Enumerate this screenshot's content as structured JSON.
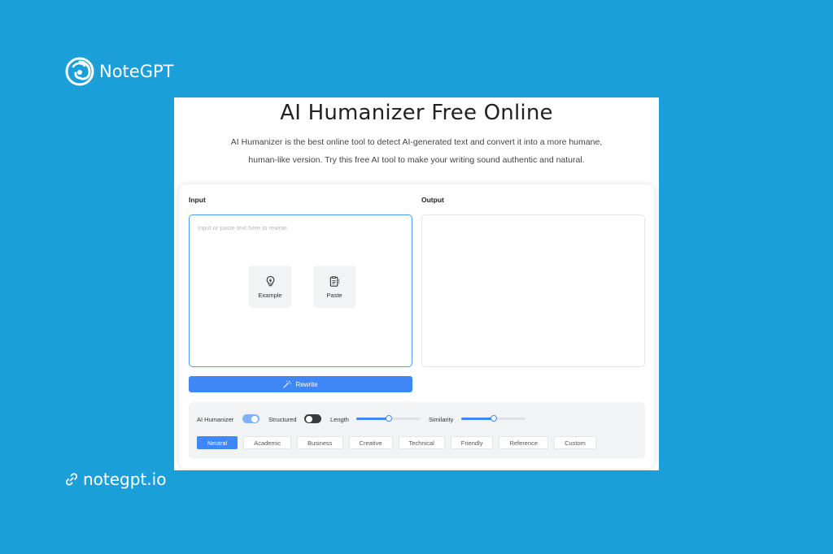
{
  "brand": {
    "name": "NoteGPT",
    "logo_icon": "swirl-logo-icon"
  },
  "site": {
    "url": "notegpt.io",
    "icon": "link-icon"
  },
  "page": {
    "title": "AI Humanizer Free Online",
    "description_line1": "AI Humanizer is the best online tool to detect AI-generated text and convert it into a more humane,",
    "description_line2": "human-like version. Try this free AI tool to make your writing sound authentic and natural."
  },
  "input": {
    "label": "Input",
    "placeholder": "Input or paste text here to rewrite.",
    "example_label": "Example",
    "example_icon": "lightbulb-icon",
    "paste_label": "Paste",
    "paste_icon": "clipboard-icon"
  },
  "output": {
    "label": "Output"
  },
  "rewrite_button": {
    "label": "Rewrite",
    "icon": "magic-wand-icon"
  },
  "settings": {
    "ai_humanizer": {
      "label": "AI Humanizer",
      "on": true
    },
    "structured": {
      "label": "Structured",
      "on": false
    },
    "length": {
      "label": "Length",
      "value": 0.5
    },
    "similarity": {
      "label": "Similarity",
      "value": 0.5
    },
    "tones": [
      "Neutral",
      "Academic",
      "Business",
      "Creative",
      "Technical",
      "Friendly",
      "Reference",
      "Custom"
    ],
    "active_tone": "Neutral"
  },
  "colors": {
    "background": "#1a9fd8",
    "accent": "#3f87f5",
    "toggle_on": "#7fb2f6",
    "toggle_off": "#3a3a3a"
  }
}
